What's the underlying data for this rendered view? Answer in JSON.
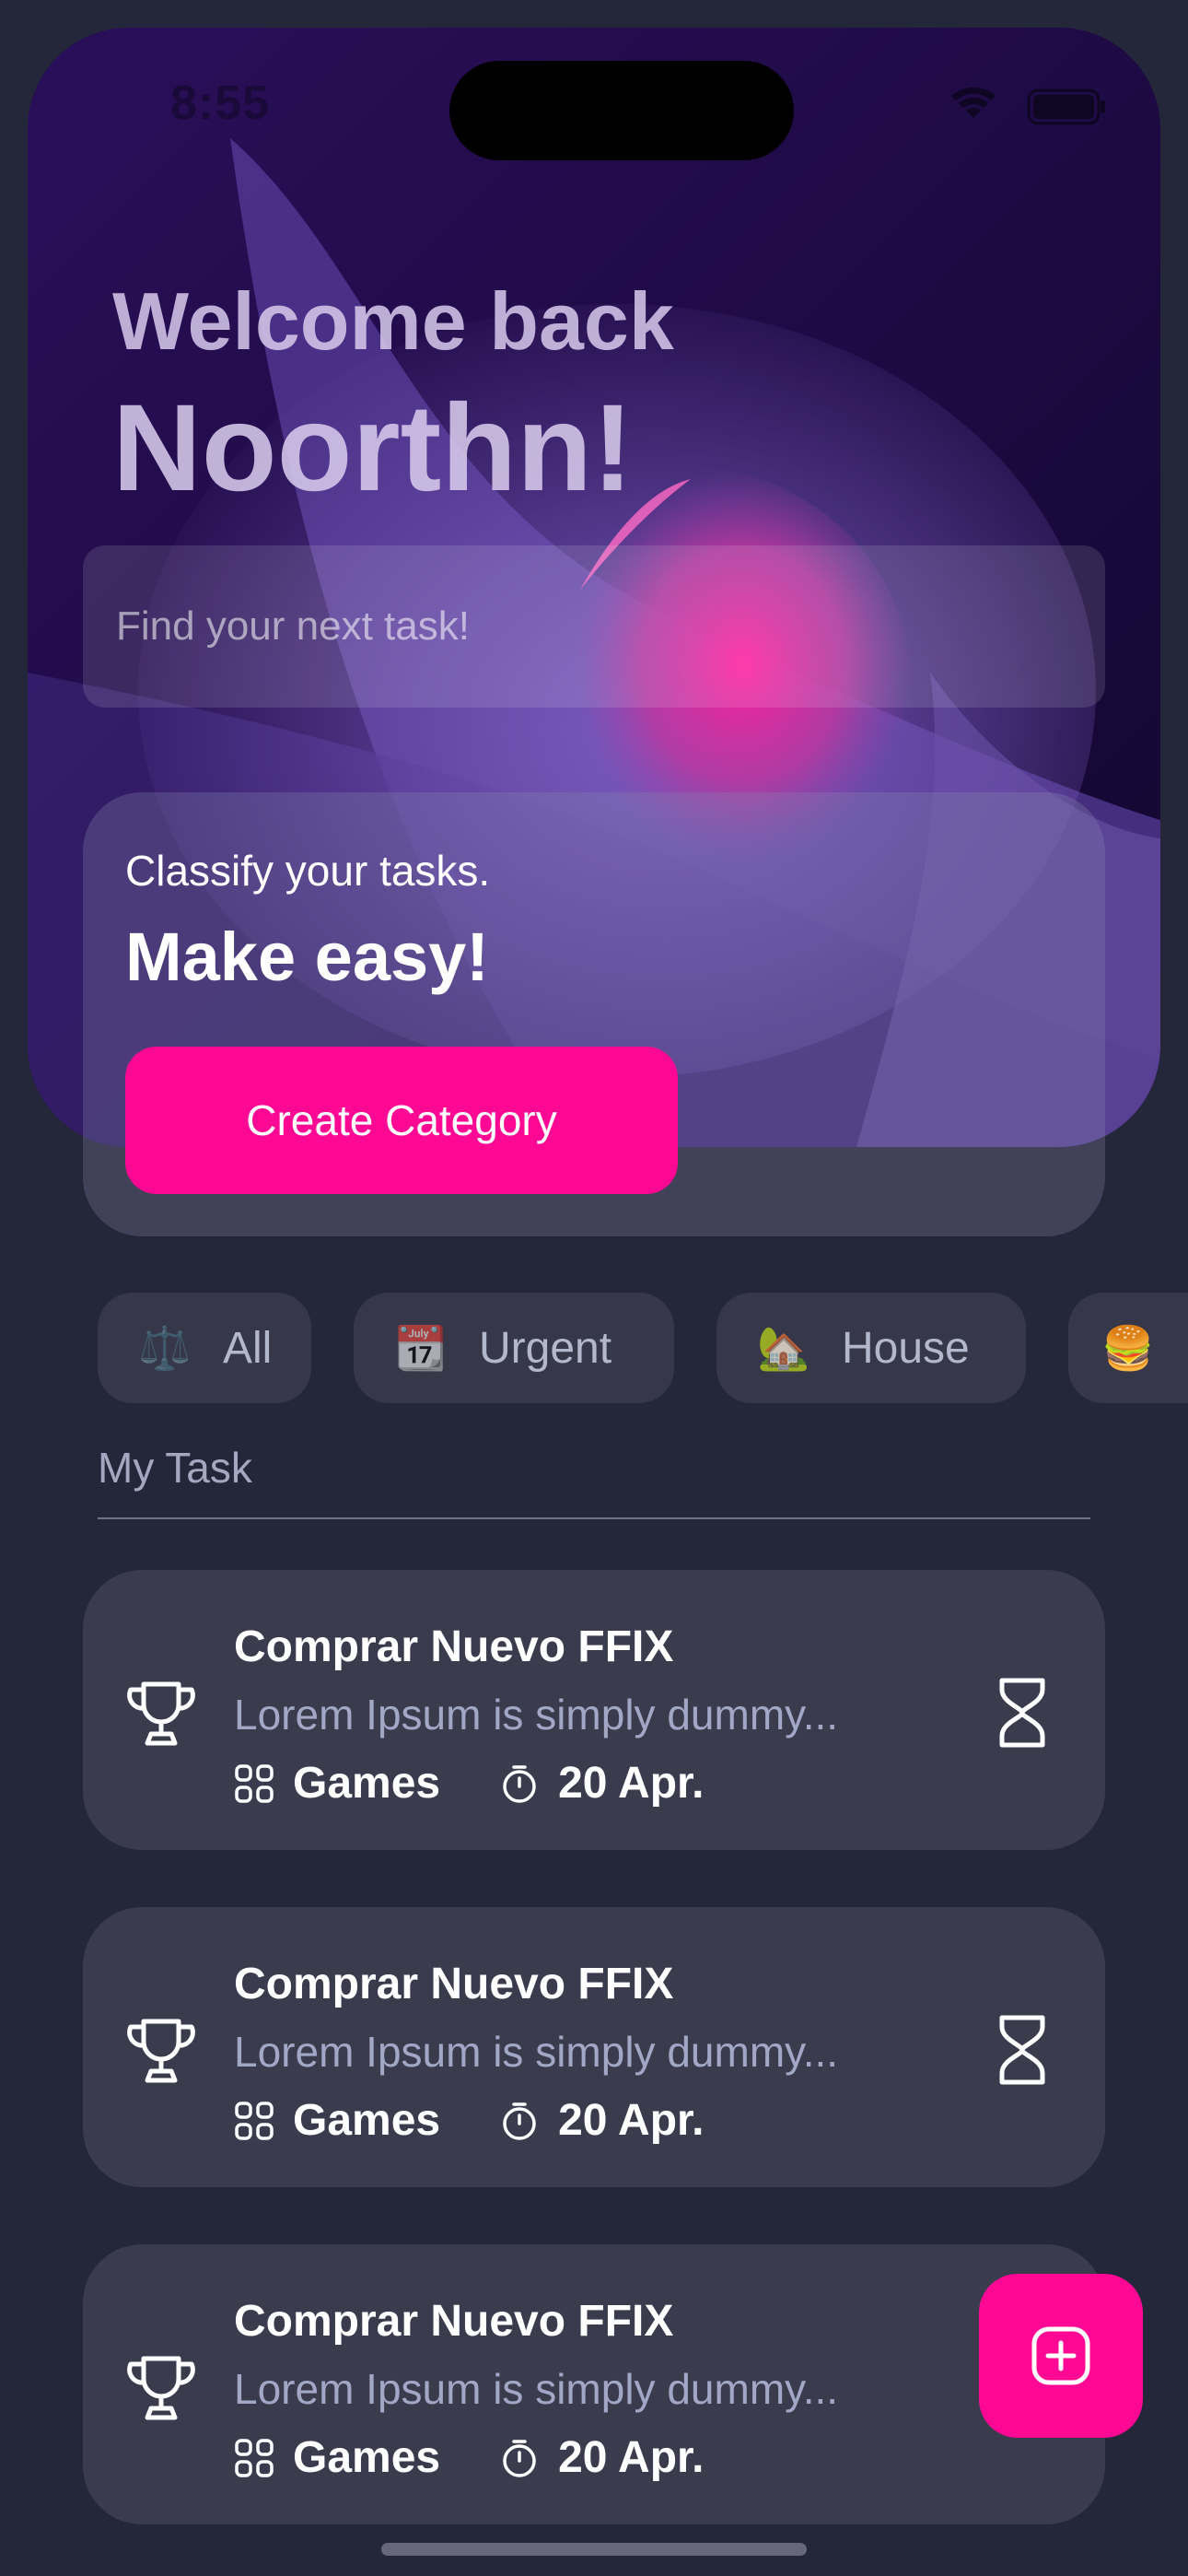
{
  "status": {
    "time": "8:55"
  },
  "hero": {
    "greeting": "Welcome back",
    "username": "Noorthn!",
    "search_placeholder": "Find your next task!"
  },
  "promo": {
    "subtitle": "Classify your tasks.",
    "title": "Make easy!",
    "button_label": "Create Category"
  },
  "categories": [
    {
      "icon": "⚖️",
      "label": "All"
    },
    {
      "icon": "📆",
      "label": "Urgent"
    },
    {
      "icon": "🏡",
      "label": "House"
    },
    {
      "icon": "🍔",
      "label": ""
    }
  ],
  "section_title": "My Task",
  "tasks": [
    {
      "title": "Comprar Nuevo FFIX",
      "description": "Lorem Ipsum is simply dummy...",
      "category": "Games",
      "date": "20 Apr."
    },
    {
      "title": "Comprar Nuevo FFIX",
      "description": "Lorem Ipsum is simply dummy...",
      "category": "Games",
      "date": "20 Apr."
    },
    {
      "title": "Comprar Nuevo FFIX",
      "description": "Lorem Ipsum is simply dummy...",
      "category": "Games",
      "date": "20 Apr."
    }
  ],
  "colors": {
    "accent": "#ff0894",
    "background": "#242639",
    "card": "#3a3c4e"
  },
  "icons": {
    "task": "trophy-icon",
    "status": "hourglass-icon",
    "category": "grid-icon",
    "date": "timer-icon",
    "fab": "add-square-icon"
  }
}
